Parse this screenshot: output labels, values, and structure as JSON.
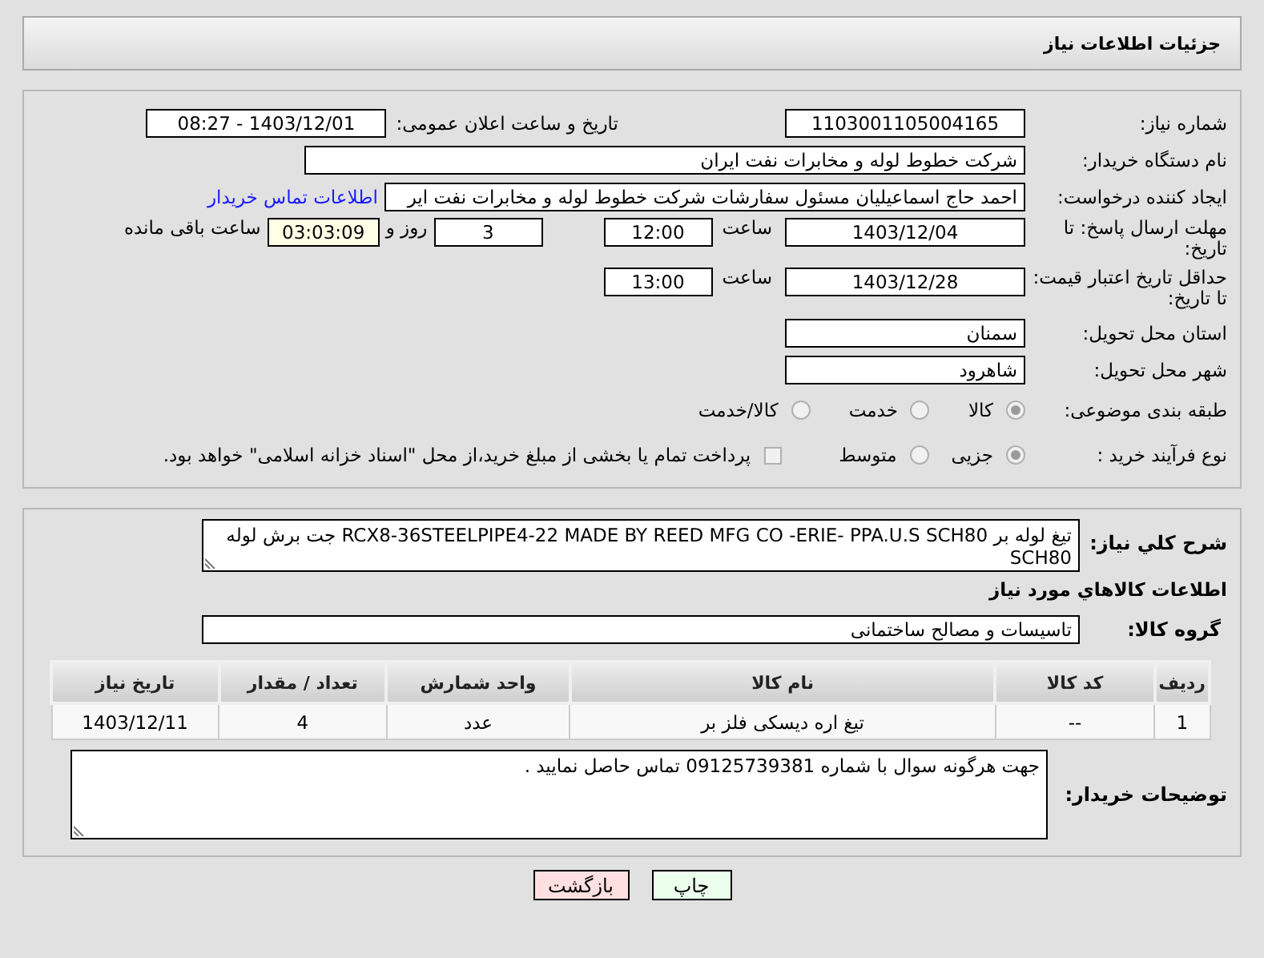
{
  "header": {
    "title": "جزئیات اطلاعات نیاز"
  },
  "need_number": {
    "label": "شماره نیاز:",
    "value": "1103001105004165"
  },
  "announce": {
    "label": "تاریخ و ساعت اعلان عمومی:",
    "value": "1403/12/01 - 08:27"
  },
  "buyer_org": {
    "label": "نام دستگاه خریدار:",
    "value": "شرکت خطوط لوله و مخابرات نفت ایران"
  },
  "requester": {
    "label": "ایجاد کننده درخواست:",
    "value": "احمد  حاج اسماعیلیان مسئول سفارشات  شرکت خطوط لوله و مخابرات نفت ایر",
    "link": "اطلاعات تماس خریدار"
  },
  "deadline": {
    "label": "مهلت ارسال پاسخ: تا تاریخ:",
    "date": "1403/12/04",
    "time_label": "ساعت",
    "time": "12:00",
    "days": "3",
    "days_label": "روز و",
    "remaining": "03:03:09",
    "remaining_label": "ساعت باقی مانده"
  },
  "validity": {
    "label": "حداقل تاریخ اعتبار قیمت: تا تاریخ:",
    "date": "1403/12/28",
    "time_label": "ساعت",
    "time": "13:00"
  },
  "province": {
    "label": "استان محل تحویل:",
    "value": "سمنان"
  },
  "city": {
    "label": "شهر محل تحویل:",
    "value": "شاهرود"
  },
  "category": {
    "label": "طبقه بندی موضوعی:",
    "options": [
      {
        "label": "کالا",
        "selected": true
      },
      {
        "label": "خدمت",
        "selected": false
      },
      {
        "label": "کالا/خدمت",
        "selected": false
      }
    ]
  },
  "purchase": {
    "label": "نوع فرآیند خرید :",
    "options": [
      {
        "label": "جزیی",
        "selected": true
      },
      {
        "label": "متوسط",
        "selected": false
      }
    ],
    "treasury": {
      "label": "پرداخت تمام یا بخشی از مبلغ خرید،از محل \"اسناد خزانه اسلامی\" خواهد بود.",
      "checked": false
    }
  },
  "description": {
    "label": "شرح کلي نياز:",
    "value": "تیغ لوله بر RCX8-36STEELPIPE4-22 MADE BY REED MFG CO -ERIE- PPA.U.S SCH80 جت برش لوله SCH80"
  },
  "items_title": "اطلاعات کالاهاي مورد نياز",
  "group": {
    "label": "گروه کالا:",
    "value": "تاسیسات و مصالح ساختمانی"
  },
  "table": {
    "columns": [
      "ردیف",
      "کد کالا",
      "نام کالا",
      "واحد شمارش",
      "تعداد / مقدار",
      "تاریخ نیاز"
    ],
    "rows": [
      [
        "1",
        "--",
        "تیغ اره دیسکی فلز بر",
        "عدد",
        "4",
        "1403/12/11"
      ]
    ]
  },
  "notes": {
    "label": "توضیحات خریدار:",
    "value": "جهت هرگونه سوال با شماره 09125739381 تماس حاصل نمایید ."
  },
  "buttons": [
    {
      "label": "چاپ",
      "kind": "print"
    },
    {
      "label": "بازگشت",
      "kind": "back"
    }
  ]
}
